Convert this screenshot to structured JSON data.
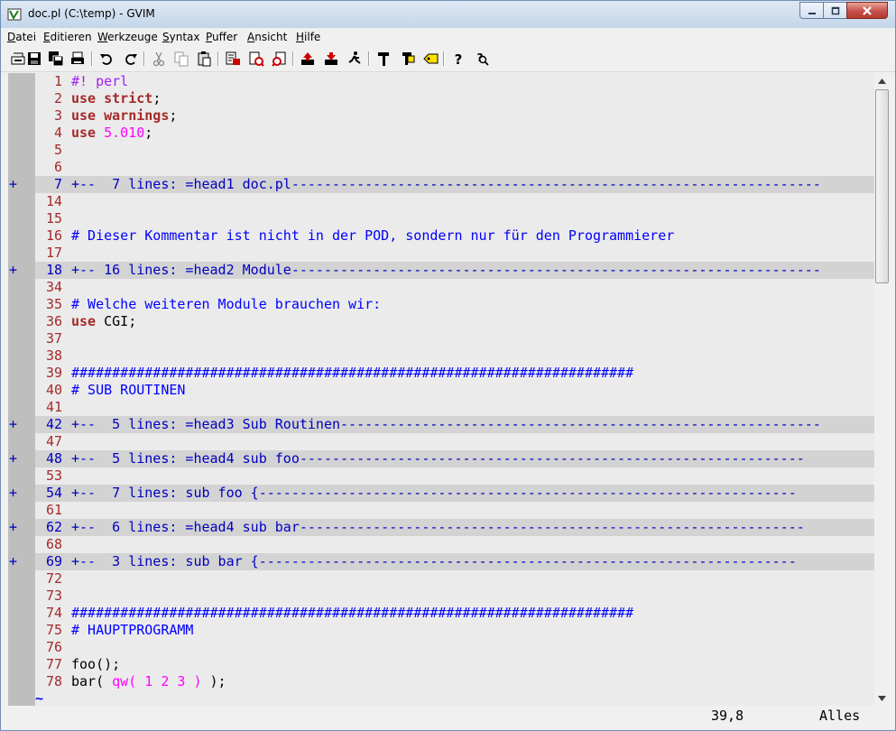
{
  "window": {
    "title": "doc.pl (C:\\temp) - GVIM",
    "buttons": {
      "minimize": "minimize-icon",
      "maximize": "maximize-icon",
      "close": "close-icon"
    }
  },
  "menu": [
    "Datei",
    "Editieren",
    "Werkzeuge",
    "Syntax",
    "Puffer",
    "Ansicht",
    "Hilfe"
  ],
  "toolbar": [
    "open-icon",
    "save-icon",
    "save-all-icon",
    "print-icon",
    "undo-icon",
    "redo-icon",
    "cut-icon",
    "copy-icon",
    "paste-icon",
    "find-replace-icon",
    "find-next-icon",
    "find-previous-icon",
    "load-session-icon",
    "save-session-icon",
    "run-script-icon",
    "make-icon",
    "build-tags-icon",
    "jump-tag-icon",
    "help-icon",
    "find-help-icon"
  ],
  "lines": [
    {
      "num": "1",
      "segs": [
        [
          "pre",
          "#! perl"
        ]
      ]
    },
    {
      "num": "2",
      "segs": [
        [
          "kw",
          "use"
        ],
        [
          "plain",
          " "
        ],
        [
          "kw",
          "strict"
        ],
        [
          "plain",
          ";"
        ]
      ]
    },
    {
      "num": "3",
      "segs": [
        [
          "kw",
          "use"
        ],
        [
          "plain",
          " "
        ],
        [
          "kw",
          "warnings"
        ],
        [
          "plain",
          ";"
        ]
      ]
    },
    {
      "num": "4",
      "segs": [
        [
          "kw",
          "use"
        ],
        [
          "plain",
          " "
        ],
        [
          "num",
          "5.010"
        ],
        [
          "plain",
          ";"
        ]
      ]
    },
    {
      "num": "5",
      "segs": []
    },
    {
      "num": "6",
      "segs": []
    },
    {
      "num": "7",
      "fold": true,
      "text": "+--  7 lines: =head1 doc.pl-----------------------------------------------------------------"
    },
    {
      "num": "14",
      "segs": []
    },
    {
      "num": "15",
      "segs": []
    },
    {
      "num": "16",
      "segs": [
        [
          "comment",
          "# Dieser Kommentar ist nicht in der POD, sondern nur für den Programmierer"
        ]
      ]
    },
    {
      "num": "17",
      "segs": []
    },
    {
      "num": "18",
      "fold": true,
      "text": "+-- 16 lines: =head2 Module-----------------------------------------------------------------"
    },
    {
      "num": "34",
      "segs": []
    },
    {
      "num": "35",
      "segs": [
        [
          "comment",
          "# Welche weiteren Module brauchen wir:"
        ]
      ]
    },
    {
      "num": "36",
      "segs": [
        [
          "kw",
          "use"
        ],
        [
          "plain",
          " CGI;"
        ]
      ]
    },
    {
      "num": "37",
      "segs": []
    },
    {
      "num": "38",
      "segs": []
    },
    {
      "num": "39",
      "segs": [
        [
          "comment",
          "#####################################################################"
        ]
      ]
    },
    {
      "num": "40",
      "segs": [
        [
          "comment",
          "# SUB ROUTINEN"
        ]
      ]
    },
    {
      "num": "41",
      "segs": []
    },
    {
      "num": "42",
      "fold": true,
      "text": "+--  5 lines: =head3 Sub Routinen-----------------------------------------------------------"
    },
    {
      "num": "47",
      "segs": []
    },
    {
      "num": "48",
      "fold": true,
      "text": "+--  5 lines: =head4 sub foo--------------------------------------------------------------"
    },
    {
      "num": "53",
      "segs": []
    },
    {
      "num": "54",
      "fold": true,
      "text": "+--  7 lines: sub foo {------------------------------------------------------------------"
    },
    {
      "num": "61",
      "segs": []
    },
    {
      "num": "62",
      "fold": true,
      "text": "+--  6 lines: =head4 sub bar--------------------------------------------------------------"
    },
    {
      "num": "68",
      "segs": []
    },
    {
      "num": "69",
      "fold": true,
      "text": "+--  3 lines: sub bar {------------------------------------------------------------------"
    },
    {
      "num": "72",
      "segs": []
    },
    {
      "num": "73",
      "segs": []
    },
    {
      "num": "74",
      "segs": [
        [
          "comment",
          "#####################################################################"
        ]
      ]
    },
    {
      "num": "75",
      "segs": [
        [
          "comment",
          "# HAUPTPROGRAMM"
        ]
      ]
    },
    {
      "num": "76",
      "segs": []
    },
    {
      "num": "77",
      "segs": [
        [
          "plain",
          "foo();"
        ]
      ]
    },
    {
      "num": "78",
      "segs": [
        [
          "plain",
          "bar( "
        ],
        [
          "str",
          "qw("
        ],
        [
          "plain",
          " "
        ],
        [
          "num",
          "1 2 3"
        ],
        [
          "plain",
          " "
        ],
        [
          "str",
          ")"
        ],
        [
          "plain",
          " );"
        ]
      ]
    }
  ],
  "fold_marker": "+",
  "tilde": "~",
  "status": {
    "position": "39,8",
    "scroll": "Alles"
  }
}
